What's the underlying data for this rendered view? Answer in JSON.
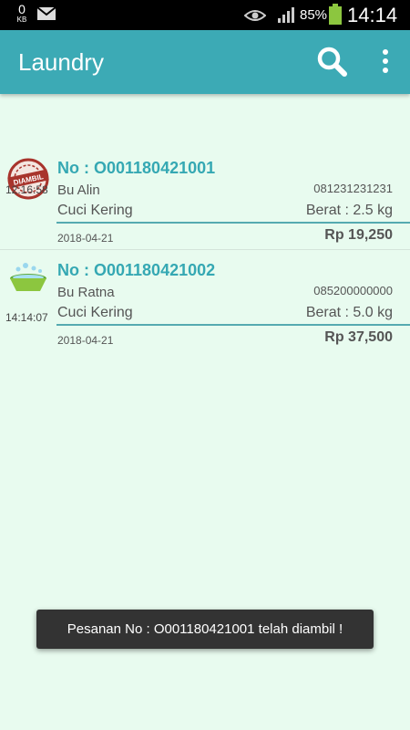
{
  "status_bar": {
    "data_counter": "0",
    "data_unit": "KB",
    "battery_percent": "85%",
    "time": "14:14",
    "icons": [
      "mail-icon",
      "eye-icon",
      "signal-icon",
      "battery-icon"
    ]
  },
  "app_bar": {
    "title": "Laundry",
    "icons": [
      "search-icon",
      "more-vert-icon"
    ],
    "color": "#3caab5"
  },
  "orders": [
    {
      "icon": "diambil-stamp-icon",
      "time": "12:16:58",
      "number": "No : O001180421001",
      "customer": "Bu Alin",
      "phone": "081231231231",
      "service": "Cuci Kering",
      "weight": "Berat : 2.5 kg",
      "date": "2018-04-21",
      "price": "Rp 19,250",
      "stamp_text": "DIAMBIL"
    },
    {
      "icon": "wash-basin-icon",
      "time": "14:14:07",
      "number": "No : O001180421002",
      "customer": "Bu Ratna",
      "phone": "085200000000",
      "service": "Cuci Kering",
      "weight": "Berat : 5.0 kg",
      "date": "2018-04-21",
      "price": "Rp 37,500"
    }
  ],
  "toast": {
    "message": "Pesanan No : O001180421001 telah diambil !"
  },
  "colors": {
    "accent": "#35a8b3",
    "background": "#e8fbef",
    "stamp": "#a8342c",
    "basin": "#8cc63f"
  }
}
